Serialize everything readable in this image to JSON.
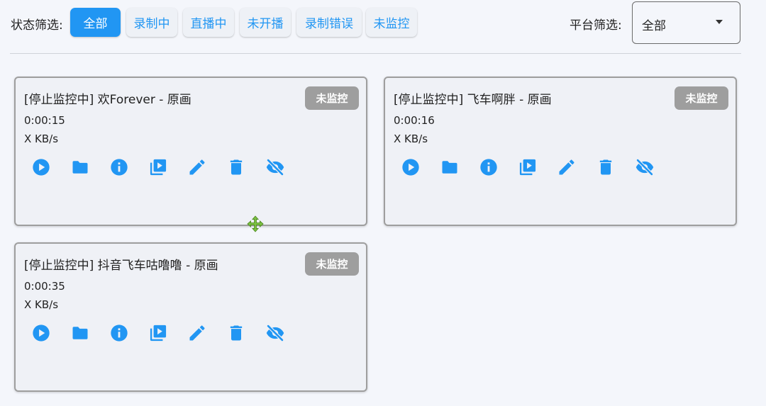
{
  "filter": {
    "status_label": "状态筛选:",
    "chips": [
      "全部",
      "录制中",
      "直播中",
      "未开播",
      "录制错误",
      "未监控"
    ],
    "active_index": 0,
    "platform_label": "平台筛选:",
    "platform_value": "全部"
  },
  "cards": [
    {
      "title": "[停止监控中] 欢Forever - 原画",
      "badge": "未监控",
      "duration": "0:00:15",
      "speed": "X KB/s"
    },
    {
      "title": "[停止监控中] 飞车啊胖 - 原画",
      "badge": "未监控",
      "duration": "0:00:16",
      "speed": "X KB/s"
    },
    {
      "title": "[停止监控中] 抖音飞车咕噜噜 - 原画",
      "badge": "未监控",
      "duration": "0:00:35",
      "speed": "X KB/s"
    }
  ],
  "card_actions": [
    "play-icon",
    "folder-icon",
    "info-icon",
    "video-library-icon",
    "edit-icon",
    "delete-icon",
    "visibility-off-icon"
  ],
  "colors": {
    "accent": "#2196f3",
    "badge": "#9e9e9e",
    "card_border": "#9e9e9e",
    "cursor": "#7cc242"
  }
}
